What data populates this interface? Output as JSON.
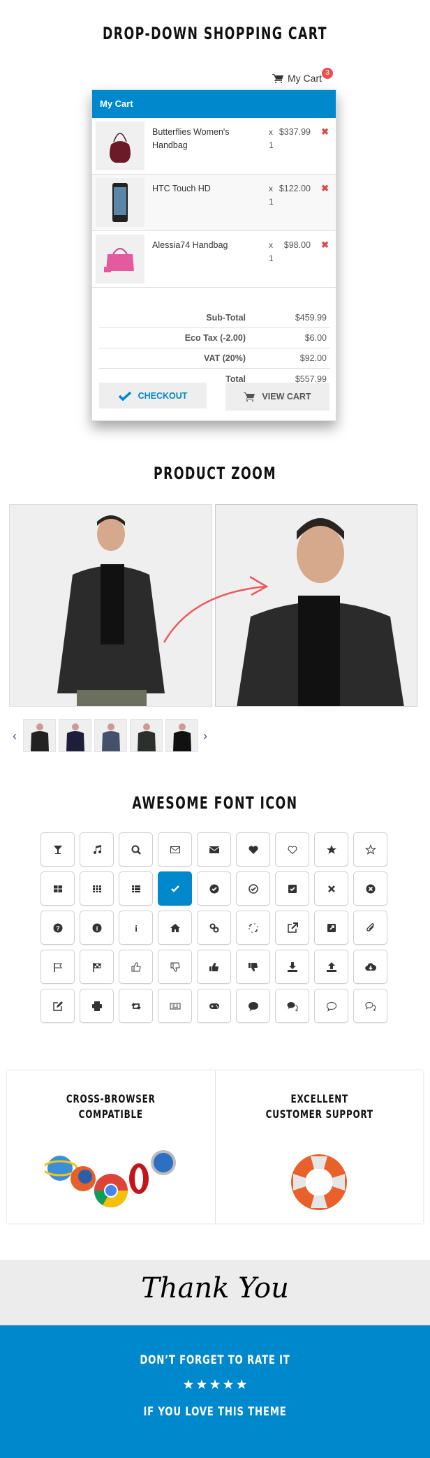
{
  "sections": {
    "cart_title": "DROP-DOWN SHOPPING CART",
    "zoom_title": "PRODUCT ZOOM",
    "icons_title": "AWESOME FONT ICON"
  },
  "cart": {
    "trigger_label": "My Cart",
    "count": "3",
    "header": "My Cart",
    "items": [
      {
        "name": "Butterflies Women's Handbag",
        "qty": "x 1",
        "price": "$337.99",
        "image": "handbag-maroon"
      },
      {
        "name": "HTC Touch HD",
        "qty": "x 1",
        "price": "$122.00",
        "image": "phone"
      },
      {
        "name": "Alessia74 Handbag",
        "qty": "x 1",
        "price": "$98.00",
        "image": "handbag-pink"
      }
    ],
    "remove_glyph": "✖",
    "totals": [
      {
        "label": "Sub-Total",
        "value": "$459.99"
      },
      {
        "label": "Eco Tax (-2.00)",
        "value": "$6.00"
      },
      {
        "label": "VAT (20%)",
        "value": "$92.00"
      },
      {
        "label": "Total",
        "value": "$557.99"
      }
    ],
    "checkout_label": "CHECKOUT",
    "view_cart_label": "VIEW CART"
  },
  "product_zoom": {
    "prev_glyph": "‹",
    "next_glyph": "›",
    "thumbnails": [
      "leather-jacket",
      "navy-shirt",
      "denim-shirt",
      "dark-shirt",
      "black-coat"
    ]
  },
  "icon_grid": {
    "active_index": 12,
    "icons": [
      "glass-icon",
      "music-icon",
      "search-icon",
      "envelope-o-icon",
      "envelope-icon",
      "heart-icon",
      "heart-o-icon",
      "star-icon",
      "star-o-icon",
      "th-large-icon",
      "th-icon",
      "th-list-icon",
      "check-icon",
      "check-circle-icon",
      "check-circle-o-icon",
      "check-square-icon",
      "times-icon",
      "times-circle-icon",
      "question-circle-icon",
      "info-circle-icon",
      "info-icon",
      "home-icon",
      "link-icon",
      "unlink-icon",
      "external-link-icon",
      "external-link-square-icon",
      "paperclip-icon",
      "flag-o-icon",
      "flag-checkered-icon",
      "thumbs-o-up-icon",
      "thumbs-o-down-icon",
      "thumbs-up-icon",
      "thumbs-down-icon",
      "download-icon",
      "upload-icon",
      "cloud-download-icon",
      "pencil-square-o-icon",
      "print-icon",
      "retweet-icon",
      "keyboard-o-icon",
      "gamepad-icon",
      "comment-icon",
      "comments-icon",
      "comment-o-icon",
      "comments-o-icon"
    ]
  },
  "features": [
    {
      "title_line1": "CROSS-BROWSER",
      "title_line2": "COMPATIBLE",
      "graphic": "browser-logos"
    },
    {
      "title_line1": "EXCELLENT",
      "title_line2": "CUSTOMER SUPPORT",
      "graphic": "lifebuoy"
    }
  ],
  "footer": {
    "thanks": "Thank You",
    "rate_line1": "DON’T FORGET TO RATE IT",
    "rating": 5,
    "rate_line2": "IF YOU LOVE THIS THEME"
  },
  "colors": {
    "accent": "#0088cc",
    "badge": "#e8514f",
    "remove": "#e04848"
  }
}
